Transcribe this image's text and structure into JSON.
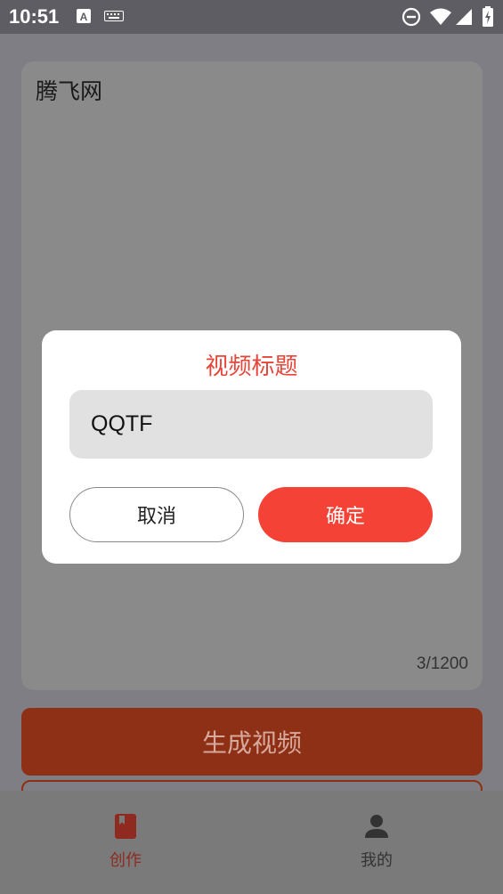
{
  "status_bar": {
    "time": "10:51"
  },
  "editor": {
    "text": "腾飞网",
    "counter": "3/1200"
  },
  "generate_button": {
    "label": "生成视频"
  },
  "tabs": [
    {
      "label": "创作",
      "icon": "bookmark-book-icon",
      "active": true
    },
    {
      "label": "我的",
      "icon": "person-icon",
      "active": false
    }
  ],
  "dialog": {
    "title": "视频标题",
    "input_value": "QQTF",
    "cancel_label": "取消",
    "confirm_label": "确定"
  },
  "colors": {
    "accent": "#f44336",
    "title_red": "#e6463a",
    "dim_generate_button": "#8e3015",
    "active_tab_dim": "#8e2a20"
  }
}
